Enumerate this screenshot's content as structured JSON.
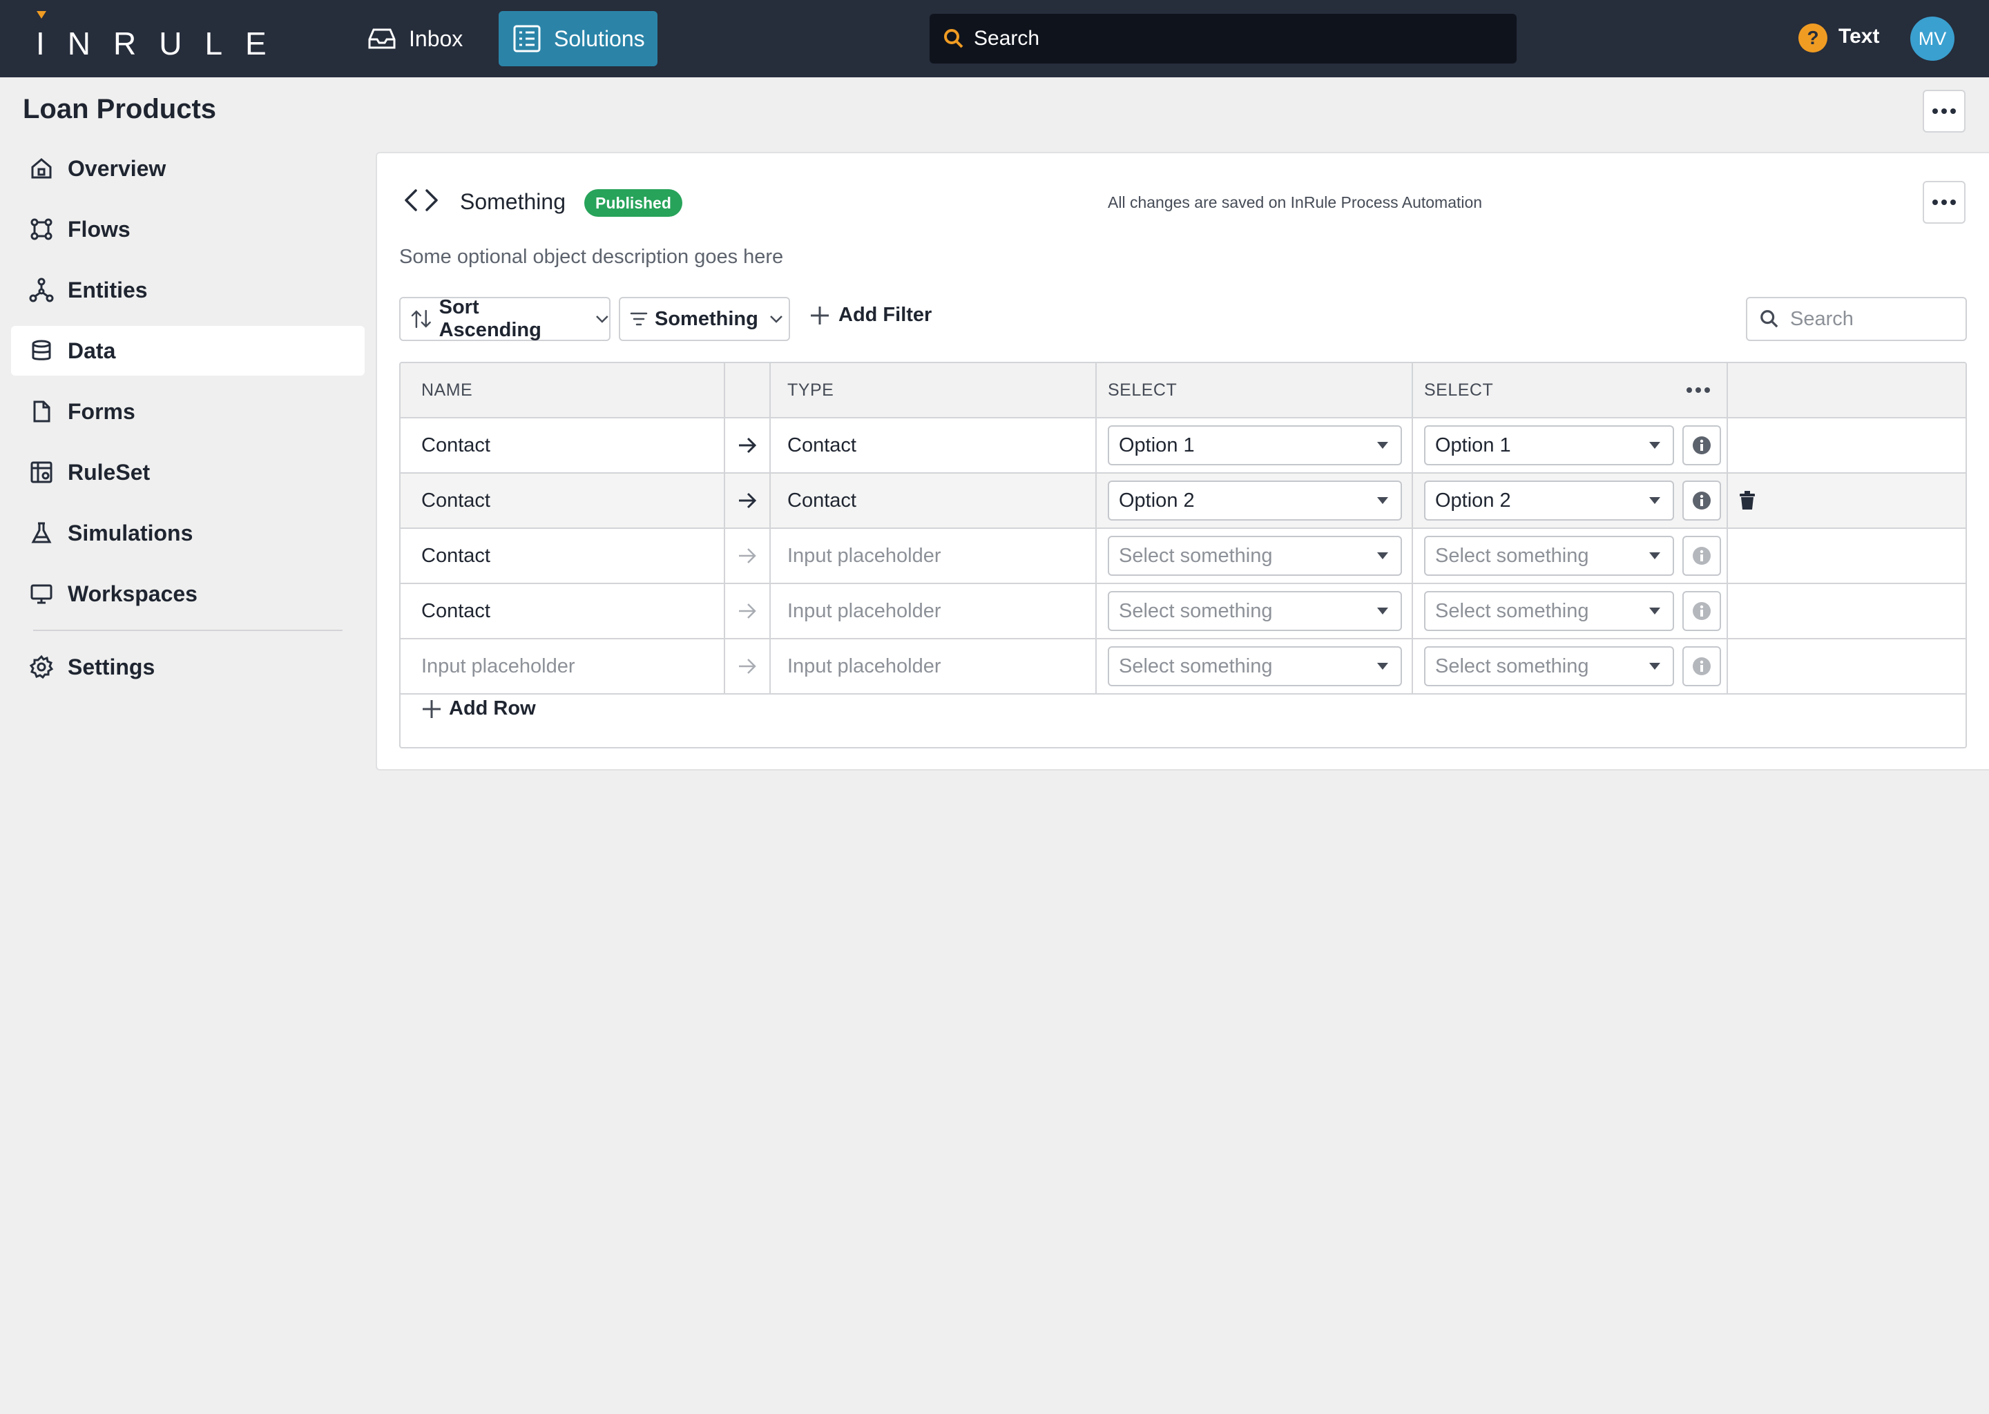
{
  "topbar": {
    "logo": "INRULE",
    "nav": {
      "inbox": "Inbox",
      "solutions": "Solutions"
    },
    "search_placeholder": "Search",
    "help_glyph": "?",
    "help_text": "Text",
    "avatar_initials": "MV"
  },
  "page": {
    "title": "Loan Products"
  },
  "sidebar": {
    "items": [
      {
        "label": "Overview",
        "icon": "home-icon"
      },
      {
        "label": "Flows",
        "icon": "flows-icon"
      },
      {
        "label": "Entities",
        "icon": "entities-icon"
      },
      {
        "label": "Data",
        "icon": "database-icon",
        "active": true
      },
      {
        "label": "Forms",
        "icon": "document-icon"
      },
      {
        "label": "RuleSet",
        "icon": "ruleset-icon"
      },
      {
        "label": "Simulations",
        "icon": "flask-icon"
      },
      {
        "label": "Workspaces",
        "icon": "monitor-icon"
      },
      {
        "label": "Settings",
        "icon": "gear-icon"
      }
    ]
  },
  "object": {
    "title": "Something",
    "status": "Published",
    "status_color": "#27a35a",
    "saved_note": "All changes are saved on InRule Process Automation",
    "description": "Some optional object description goes here"
  },
  "toolbar": {
    "sort_label": "Sort Ascending",
    "filter_label": "Something",
    "add_filter": "Add Filter",
    "search_placeholder": "Search"
  },
  "table": {
    "headers": {
      "name": "NAME",
      "type": "TYPE",
      "select1": "SELECT",
      "select2": "SELECT"
    },
    "rows": [
      {
        "name": "Contact",
        "type": "Contact",
        "select1": "Option 1",
        "select2": "Option 1"
      },
      {
        "name": "Contact",
        "type": "Contact",
        "select1": "Option 2",
        "select2": "Option 2"
      },
      {
        "name": "Contact",
        "type": "Input placeholder",
        "select1": "Select something",
        "select2": "Select something"
      },
      {
        "name": "Contact",
        "type": "Input placeholder",
        "select1": "Select something",
        "select2": "Select something"
      },
      {
        "name": "Input placeholder",
        "type": "Input placeholder",
        "select1": "Select something",
        "select2": "Select something"
      }
    ],
    "add_row": "Add Row"
  },
  "colors": {
    "topbar": "#262d3b",
    "accent_nav": "#2b84a8",
    "help": "#f09c23",
    "avatar": "#3aa0d0"
  }
}
